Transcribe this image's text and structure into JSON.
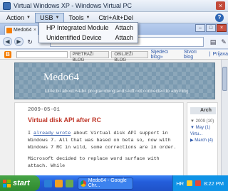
{
  "vpc": {
    "title": "Virtual Windows XP - Windows Virtual PC",
    "menu": {
      "action": "Action",
      "usb": "USB",
      "tools": "Tools",
      "cad": "Ctrl+Alt+Del",
      "help": "?"
    },
    "usb_dropdown": [
      {
        "device": "HP Integrated Module",
        "action": "Attach"
      },
      {
        "device": "Unidentified Device",
        "action": "Attach"
      }
    ]
  },
  "browser": {
    "tab_title": "Medo64",
    "tab_close": "×",
    "controls": {
      "minimize": "–",
      "maximize": "□",
      "close": "×"
    }
  },
  "blogger_bar": {
    "logo": "B",
    "search_blog": "PRETRAŽI BLOG",
    "flag_blog": "OBILJEŽI BLOG",
    "next_blog": "Sljedeći blog»",
    "create_blog": "Stvori blog",
    "separator": "|",
    "sign_in": "Prijava"
  },
  "blog": {
    "title": "Medo64",
    "description": "Little bit about 64-bit programming and stuff not connected to anything",
    "post": {
      "date": "2009-05-01",
      "title": "Virtual disk API after RC",
      "p1_pre": "I ",
      "p1_link": "already wrote",
      "p1_post": " about Virtual disk API support in Windows 7. All that was based on beta so, now with Windows 7 RC in wild, some corrections are in order.",
      "p2": "Microsoft decided to replace word surface with attach. While"
    },
    "sidebar": {
      "heading": "Arch",
      "items": [
        "▼ 2009 (10)",
        "▼ May (1)",
        "Virtu...",
        "▶ March (4)"
      ]
    }
  },
  "taskbar": {
    "start": "start",
    "task_button": "Medo64 - Google Chr...",
    "tray_label": "HR",
    "clock": "8:22 PM"
  }
}
